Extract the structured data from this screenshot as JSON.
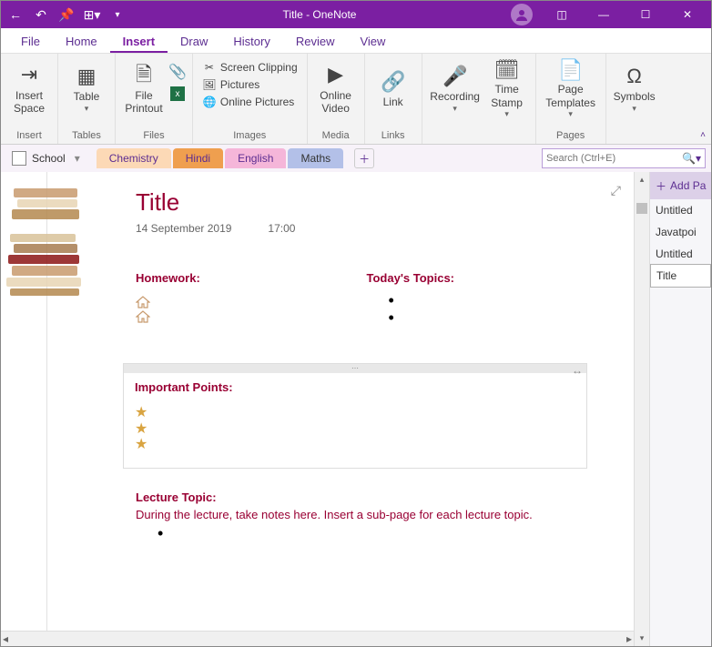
{
  "titlebar": {
    "title": "Title  -  OneNote"
  },
  "menu": {
    "file": "File",
    "home": "Home",
    "insert": "Insert",
    "draw": "Draw",
    "history": "History",
    "review": "Review",
    "view": "View",
    "active": "insert"
  },
  "ribbon": {
    "insert_space": "Insert\nSpace",
    "tables": "Table",
    "file_printout": "File\nPrintout",
    "screen_clipping": "Screen Clipping",
    "pictures": "Pictures",
    "online_pictures": "Online Pictures",
    "online_video": "Online\nVideo",
    "link": "Link",
    "recording": "Recording",
    "time_stamp": "Time\nStamp",
    "page_templates": "Page\nTemplates",
    "symbols": "Symbols",
    "g_insert": "Insert",
    "g_tables": "Tables",
    "g_files": "Files",
    "g_images": "Images",
    "g_media": "Media",
    "g_links": "Links",
    "g_pages": "Pages"
  },
  "nav": {
    "notebook": "School",
    "tabs": [
      {
        "label": "Chemistry",
        "bg": "#fcd9b6",
        "fg": "#5c2d91"
      },
      {
        "label": "Hindi",
        "bg": "#ef9f4f",
        "fg": "#5c2d91"
      },
      {
        "label": "English",
        "bg": "#f5b6d9",
        "fg": "#5c2d91"
      },
      {
        "label": "Maths",
        "bg": "#b3c0e8",
        "fg": "#333"
      }
    ],
    "search_placeholder": "Search (Ctrl+E)"
  },
  "page": {
    "title": "Title",
    "date": "14 September 2019",
    "time": "17:00",
    "homework_hd": "Homework:",
    "topics_hd": "Today's Topics:",
    "important_hd": "Important Points:",
    "lecture_hd": "Lecture Topic:",
    "lecture_txt": "During the lecture, take notes here.  Insert a sub-page for each lecture topic."
  },
  "sidepane": {
    "add_page": "Add Pa",
    "items": [
      "Untitled",
      "Javatpoi",
      "Untitled",
      "Title"
    ],
    "selected": 3
  }
}
